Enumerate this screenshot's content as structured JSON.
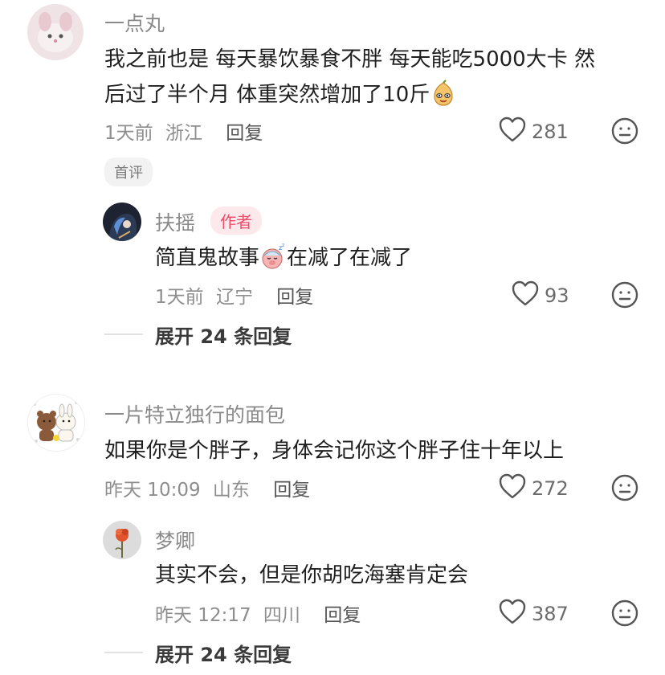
{
  "comments": [
    {
      "user": "一点丸",
      "text_line1": "我之前也是 每天暴饮暴食不胖 每天能吃5000大卡 然",
      "text_line2": "后过了半个月 体重突然增加了10斤",
      "time": "1天前",
      "location": "浙江",
      "reply_label": "回复",
      "likes": "281",
      "badge": "首评",
      "reply": {
        "user": "扶摇",
        "author_badge": "作者",
        "text_a": "简直鬼故事",
        "text_b": "在减了在减了",
        "time": "1天前",
        "location": "辽宁",
        "reply_label": "回复",
        "likes": "93"
      },
      "expand_label": "展开 24 条回复"
    },
    {
      "user": "一片特立独行的面包",
      "text_line1": "如果你是个胖子，身体会记你这个胖子住十年以上",
      "time": "昨天 10:09",
      "location": "山东",
      "reply_label": "回复",
      "likes": "272",
      "reply": {
        "user": "梦卿",
        "text_a": "其实不会，但是你胡吃海塞肯定会",
        "time": "昨天 12:17",
        "location": "四川",
        "reply_label": "回复",
        "likes": "387"
      },
      "expand_label": "展开 24 条回复"
    }
  ],
  "icons": {
    "like": "heart-outline-icon",
    "dislike": "meh-face-icon",
    "emoji1": "pear-face-emoji",
    "emoji2": "sleepy-pig-emoji"
  }
}
